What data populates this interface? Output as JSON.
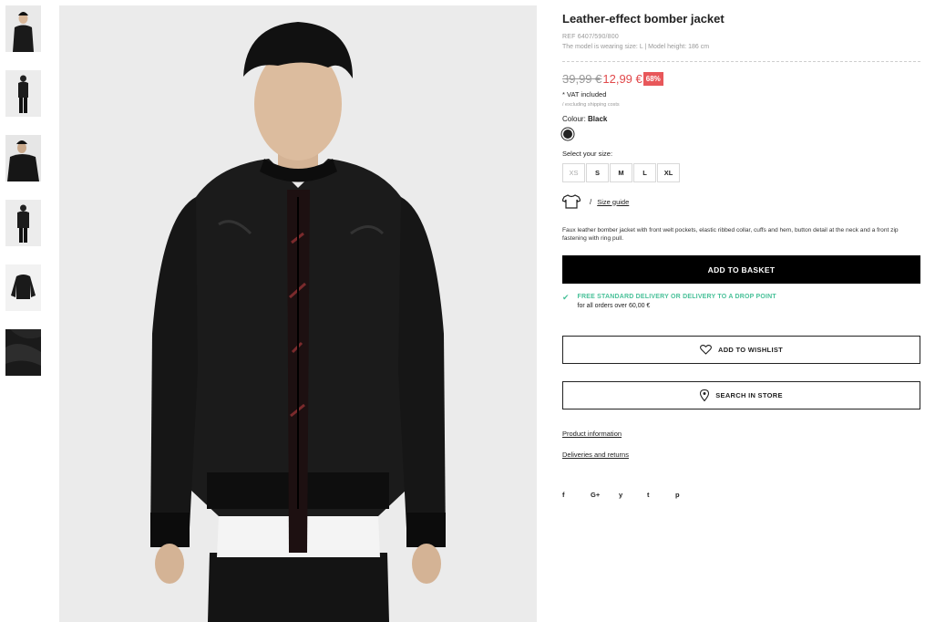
{
  "product": {
    "title": "Leather-effect bomber jacket",
    "ref": "REF 6407/590/800",
    "model_info": "The model is wearing size: L | Model height: 186 cm"
  },
  "price": {
    "old": "39,99 €",
    "new": "12,99 €",
    "discount": "68%",
    "vat": "* VAT included",
    "shipping": "/ excluding shipping costs"
  },
  "colour": {
    "label": "Colour:",
    "value": "Black",
    "swatch": "#222222"
  },
  "sizes": {
    "label": "Select your size:",
    "options": [
      "XS",
      "S",
      "M",
      "L",
      "XL"
    ]
  },
  "size_guide": {
    "slash": "/",
    "label": "Size guide",
    "icon": "tshirt-icon"
  },
  "description": "Faux leather bomber jacket with front welt pockets, elastic ribbed collar, cuffs and hem, button detail at the neck and a front zip fastening with ring pull.",
  "actions": {
    "basket": "ADD TO BASKET",
    "wishlist": "ADD TO WISHLIST",
    "store": "SEARCH IN STORE"
  },
  "delivery": {
    "headline": "FREE STANDARD DELIVERY OR DELIVERY TO A DROP POINT",
    "sub": "for all orders over 60,00 €",
    "color": "#49c199"
  },
  "links": {
    "product_info": "Product information",
    "deliveries": "Deliveries and returns"
  },
  "social": [
    "f",
    "G+",
    "y",
    "t",
    "p"
  ],
  "thumbnails": [
    "front-view",
    "full-body",
    "close-up",
    "side-view",
    "flat-lay",
    "texture-detail"
  ]
}
